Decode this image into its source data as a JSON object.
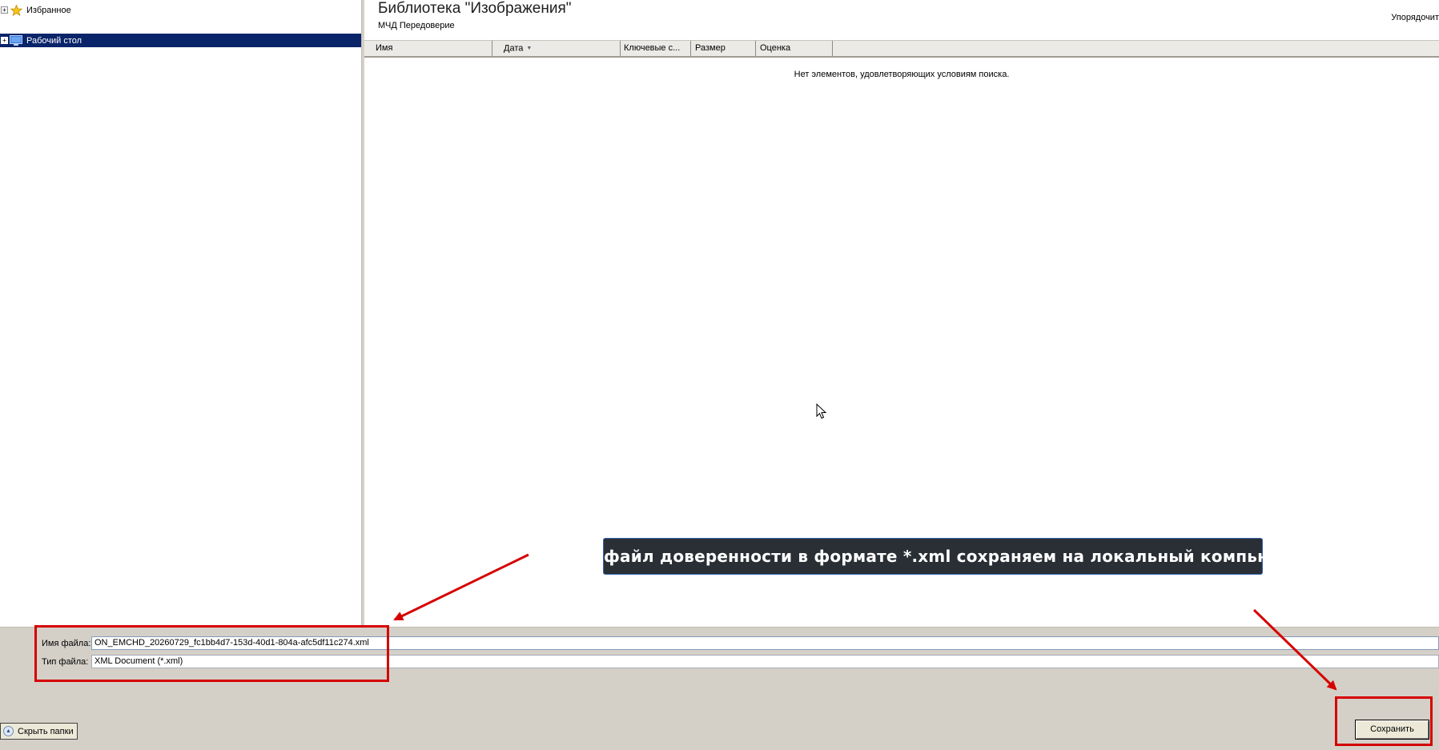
{
  "nav": {
    "items": [
      {
        "label": "Избранное",
        "icon": "star-icon",
        "expander": "+",
        "selected": false
      },
      {
        "label": "Рабочий стол",
        "icon": "desktop-icon",
        "expander": "+",
        "selected": true
      }
    ]
  },
  "content": {
    "title": "Библиотека \"Изображения\"",
    "subtitle": "МЧД Передоверие",
    "arrange_label": "Упорядочит",
    "columns": [
      {
        "label": "Имя"
      },
      {
        "label": "Дата",
        "sorted": true
      },
      {
        "label": "Ключевые с..."
      },
      {
        "label": "Размер"
      },
      {
        "label": "Оценка"
      }
    ],
    "empty_message": "Нет элементов, удовлетворяющих условиям поиска."
  },
  "form": {
    "filename_label": "Имя файла:",
    "filename_value": "ON_EMCHD_20260729_fc1bb4d7-153d-40d1-804a-afc5df11c274.xml",
    "filetype_label": "Тип файла:",
    "filetype_value": "XML Document (*.xml)"
  },
  "buttons": {
    "hide_folders": "Скрыть папки",
    "save": "Сохранить"
  },
  "annotation": {
    "tooltip_text": "файл доверенности в формате *.xml сохраняем на локальный компьютер",
    "highlight_color": "#d50000"
  },
  "colors": {
    "selection": "#0a246a",
    "panel": "#d4d0c8",
    "tooltip_bg": "#2a2f36"
  }
}
